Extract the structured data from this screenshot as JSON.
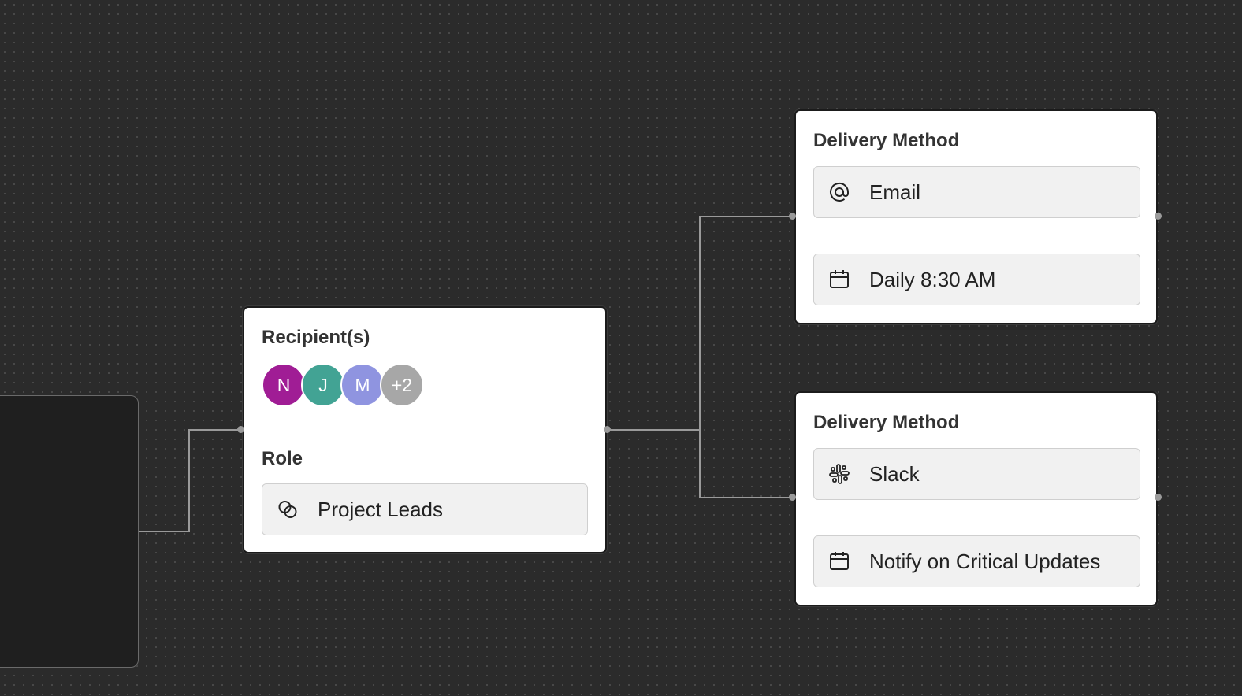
{
  "recipients_card": {
    "title": "Recipient(s)",
    "avatars": [
      {
        "initial": "N",
        "color": "#a01d95"
      },
      {
        "initial": "J",
        "color": "#42a394"
      },
      {
        "initial": "M",
        "color": "#8f94e0"
      },
      {
        "initial": "+2",
        "color": "#a7a7a7"
      }
    ],
    "role_label": "Role",
    "role_value": "Project Leads"
  },
  "delivery_cards": [
    {
      "title": "Delivery Method",
      "method": "Email",
      "method_icon": "at-icon",
      "schedule": "Daily 8:30 AM",
      "schedule_icon": "calendar-icon"
    },
    {
      "title": "Delivery Method",
      "method": "Slack",
      "method_icon": "slack-icon",
      "schedule": "Notify on Critical Updates",
      "schedule_icon": "calendar-icon"
    }
  ],
  "colors": {
    "canvas": "#2b2b2b",
    "edge": "#9a9a9a",
    "card_bg": "#ffffff",
    "field_bg": "#f1f1f1"
  }
}
